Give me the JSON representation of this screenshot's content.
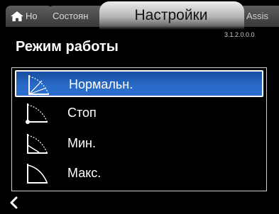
{
  "tabs": {
    "home_label": "Ho",
    "status_label": "Состоян",
    "active_label": "Настройки",
    "assist_label": "Assis"
  },
  "version": "3.1.2.0.0.0",
  "page_title": "Режим работы",
  "items": [
    {
      "label": "Нормальн.",
      "icon": "normal-mode-icon",
      "selected": true
    },
    {
      "label": "Стоп",
      "icon": "stop-mode-icon",
      "selected": false
    },
    {
      "label": "Мин.",
      "icon": "min-mode-icon",
      "selected": false
    },
    {
      "label": "Макс.",
      "icon": "max-mode-icon",
      "selected": false
    }
  ],
  "colors": {
    "selected_bg": "#2a6cc9",
    "background": "#000000",
    "active_tab": "#e0e0e0"
  }
}
